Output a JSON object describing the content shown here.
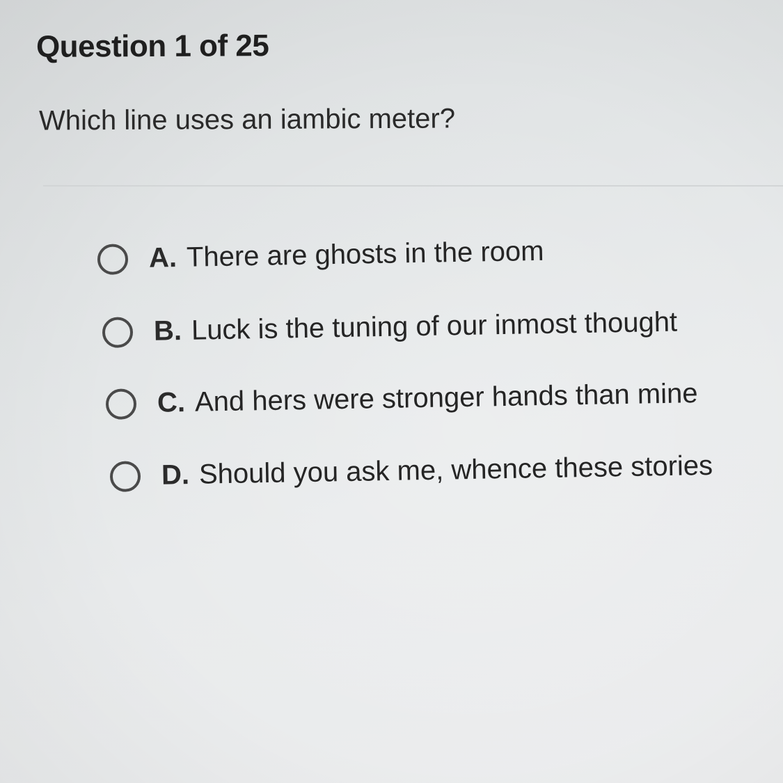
{
  "header": {
    "title": "Question 1 of 25"
  },
  "question": {
    "text": "Which line uses an iambic meter?"
  },
  "options": [
    {
      "letter": "A.",
      "text": "There are ghosts in the room"
    },
    {
      "letter": "B.",
      "text": "Luck is the tuning of our inmost thought"
    },
    {
      "letter": "C.",
      "text": "And hers were stronger hands than mine"
    },
    {
      "letter": "D.",
      "text": "Should you ask me, whence these stories"
    }
  ]
}
